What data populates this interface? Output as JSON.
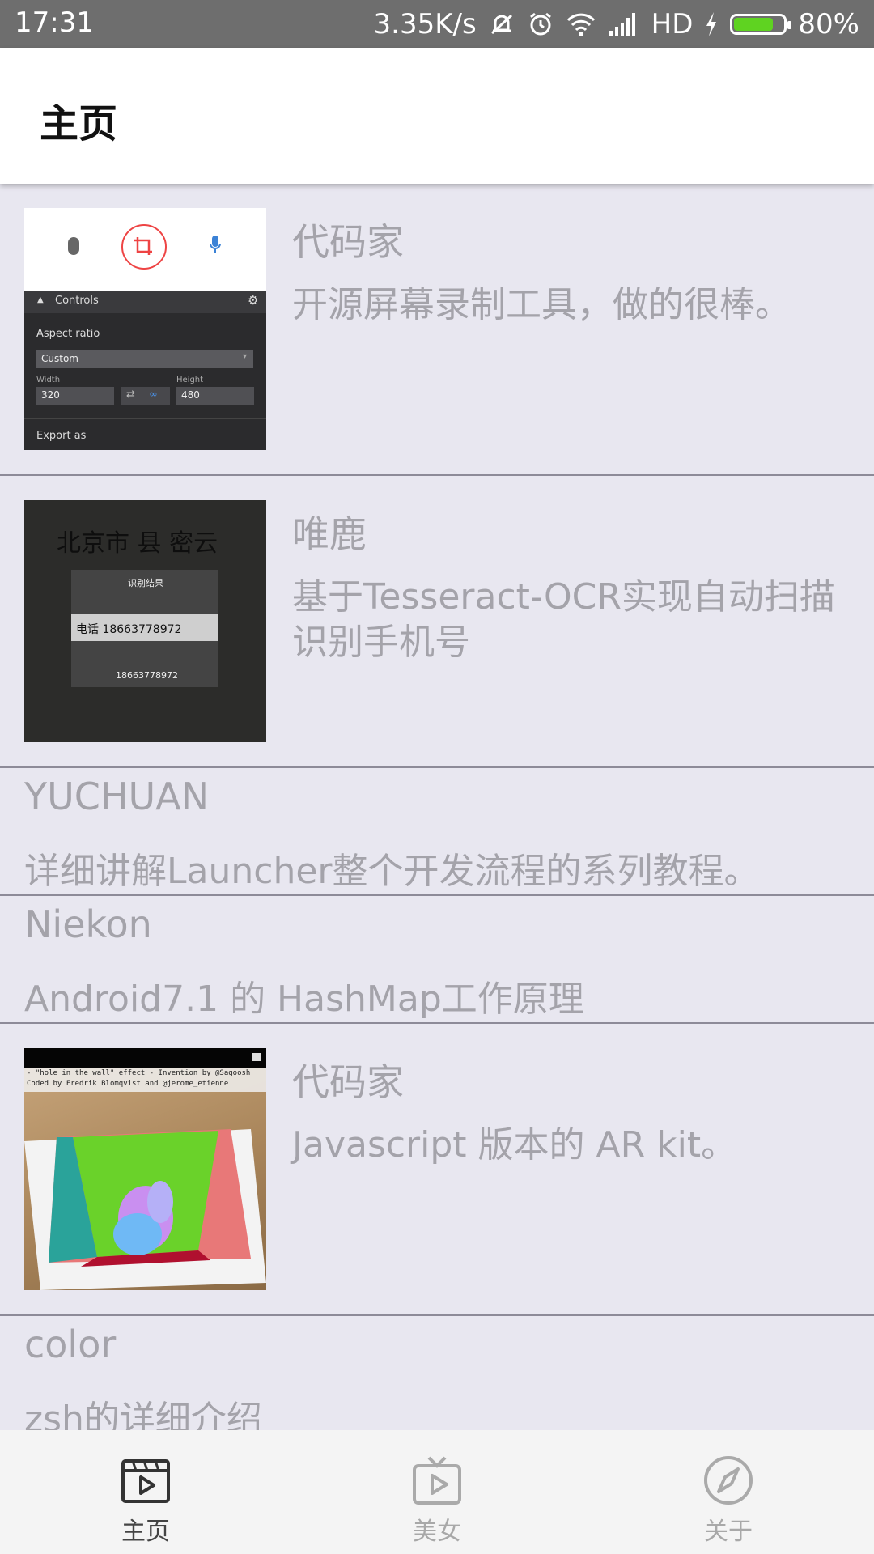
{
  "status_bar": {
    "time": "17:31",
    "net_speed": "3.35K/s",
    "network": "HD",
    "battery": "80%",
    "battery_level": 0.8
  },
  "app_bar": {
    "title": "主页"
  },
  "items": [
    {
      "type": "image",
      "author": "代码家",
      "desc": "开源屏幕录制工具，做的很棒。",
      "thumb": {
        "controls": "Controls",
        "aspect_ratio": "Aspect ratio",
        "custom": "Custom",
        "width_label": "Width",
        "height_label": "Height",
        "width": "320",
        "height": "480",
        "export": "Export as"
      }
    },
    {
      "type": "image",
      "author": "唯鹿",
      "desc": "基于Tesseract-OCR实现自动扫描识别手机号",
      "thumb": {
        "line1": "北京市 县 密云",
        "result_title": "识别结果",
        "band_text": "电话 18663778972",
        "number": "18663778972"
      }
    },
    {
      "type": "text",
      "author": "YUCHUAN",
      "desc": "详细讲解Launcher整个开发流程的系列教程。"
    },
    {
      "type": "text",
      "author": "Niekon",
      "desc": "Android7.1 的 HashMap工作原理"
    },
    {
      "type": "image",
      "author": "代码家",
      "desc": "Javascript 版本的 AR kit。",
      "thumb": {
        "line1": "- \"hole in the wall\" effect - Invention by @Sagoosh",
        "line2": "Coded by Fredrik Blomqvist and @jerome_etienne"
      }
    },
    {
      "type": "text",
      "author": "color",
      "desc": "zsh的详细介绍"
    }
  ],
  "nav": {
    "tabs": [
      {
        "label": "主页",
        "icon": "film-icon",
        "active": true
      },
      {
        "label": "美女",
        "icon": "tv-icon",
        "active": false
      },
      {
        "label": "关于",
        "icon": "compass-icon",
        "active": false
      }
    ]
  },
  "colors": {
    "background": "#e8e7f0",
    "status_bar": "#6e6e6e",
    "text_muted": "#a4a3aa",
    "battery": "#5fd321"
  }
}
